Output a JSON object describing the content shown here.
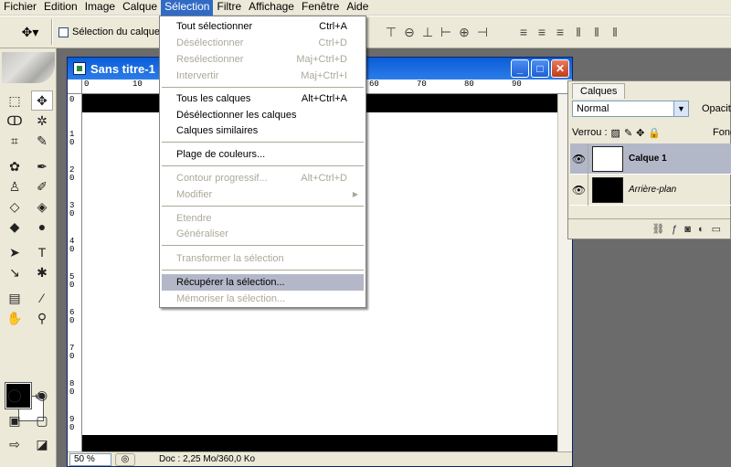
{
  "menubar": [
    "Fichier",
    "Edition",
    "Image",
    "Calque",
    "Sélection",
    "Filtre",
    "Affichage",
    "Fenêtre",
    "Aide"
  ],
  "options": {
    "tool_icon": "move-tool-icon",
    "auto_select_label": "Sélection du calque"
  },
  "document": {
    "title": "Sans titre-1",
    "minimize": "_",
    "maximize": "□",
    "close": "✕",
    "ruler_h": [
      "0",
      "10",
      "60",
      "70",
      "80",
      "90"
    ],
    "ruler_v": [
      "0",
      "10",
      "20",
      "30",
      "40",
      "50",
      "60",
      "70",
      "80",
      "90"
    ],
    "zoom": "50 %",
    "status": "Doc : 2,25 Mo/360,0 Ko"
  },
  "selection_menu": {
    "items": [
      {
        "label": "Tout sélectionner",
        "shortcut": "Ctrl+A",
        "disabled": false
      },
      {
        "label": "Désélectionner",
        "shortcut": "Ctrl+D",
        "disabled": true
      },
      {
        "label": "Resélectionner",
        "shortcut": "Maj+Ctrl+D",
        "disabled": true
      },
      {
        "label": "Intervertir",
        "shortcut": "Maj+Ctrl+I",
        "disabled": true
      },
      {
        "label": "Tous les calques",
        "shortcut": "Alt+Ctrl+A",
        "disabled": false
      },
      {
        "label": "Désélectionner les calques",
        "shortcut": "",
        "disabled": false
      },
      {
        "label": "Calques similaires",
        "shortcut": "",
        "disabled": false
      },
      {
        "label": "Plage de couleurs...",
        "shortcut": "",
        "disabled": false
      },
      {
        "label": "Contour progressif...",
        "shortcut": "Alt+Ctrl+D",
        "disabled": true
      },
      {
        "label": "Modifier",
        "shortcut": "",
        "disabled": true,
        "submenu": true
      },
      {
        "label": "Etendre",
        "shortcut": "",
        "disabled": true
      },
      {
        "label": "Généraliser",
        "shortcut": "",
        "disabled": true
      },
      {
        "label": "Transformer la sélection",
        "shortcut": "",
        "disabled": true
      },
      {
        "label": "Récupérer la sélection...",
        "shortcut": "",
        "disabled": false,
        "highlighted": true
      },
      {
        "label": "Mémoriser la sélection...",
        "shortcut": "",
        "disabled": true
      }
    ]
  },
  "layers_panel": {
    "tab": "Calques",
    "blend_mode": "Normal",
    "opacity_label": "Opacité",
    "lock_label": "Verrou :",
    "fill_label": "Fond",
    "layers": [
      {
        "name": "Calque 1",
        "selected": true,
        "thumb": "#ffffff"
      },
      {
        "name": "Arrière-plan",
        "selected": false,
        "thumb": "#000000"
      }
    ]
  },
  "colors": {
    "foreground": "#000000",
    "background": "#ffffff",
    "menu_highlight": "#b4b7c8",
    "titlebar": "#0a5dd8"
  }
}
